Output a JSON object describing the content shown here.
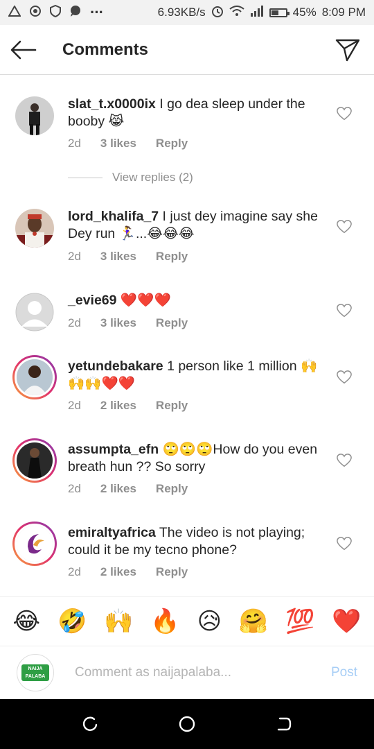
{
  "status_bar": {
    "speed": "6.93KB/s",
    "battery": "45%",
    "time": "8:09 PM",
    "dots": "···"
  },
  "header": {
    "title": "Comments"
  },
  "comments": [
    {
      "username": "slat_t.x0000ix",
      "text": " I go dea sleep under the booby 😹",
      "age": "2d",
      "likes": "3 likes",
      "reply": "Reply",
      "avatar": "photo"
    },
    {
      "username": "lord_khalifa_7",
      "text": " I just dey imagine say she Dey run 🏃‍♀️...😂😂😂",
      "age": "2d",
      "likes": "3 likes",
      "reply": "Reply",
      "avatar": "photo"
    },
    {
      "username": "_evie69",
      "text": " ❤️❤️❤️",
      "age": "2d",
      "likes": "3 likes",
      "reply": "Reply",
      "avatar": "default"
    },
    {
      "username": "yetundebakare",
      "text": " 1 person like 1 million 🙌🙌🙌❤️❤️",
      "age": "2d",
      "likes": "2 likes",
      "reply": "Reply",
      "avatar": "story"
    },
    {
      "username": "assumpta_efn",
      "text": " 🙄🙄🙄How do you even breath hun ?? So sorry",
      "age": "2d",
      "likes": "2 likes",
      "reply": "Reply",
      "avatar": "story"
    },
    {
      "username": "emiraltyafrica",
      "text": " The video is not playing; could it be my tecno phone?",
      "age": "2d",
      "likes": "2 likes",
      "reply": "Reply",
      "avatar": "story"
    }
  ],
  "view_replies": "View replies (2)",
  "emoji_bar": [
    "😂",
    "🤣",
    "🙌",
    "🔥",
    "😥",
    "🤗",
    "💯",
    "❤️"
  ],
  "composer": {
    "placeholder": "Comment as naijapalaba...",
    "post_label": "Post",
    "avatar_text_1": "NAIJA",
    "avatar_text_2": "PALABA"
  },
  "colors": {
    "text": "#262626",
    "muted": "#8e8e8e",
    "post_disabled": "#a7cef6",
    "heart_red": "#ed4956"
  }
}
